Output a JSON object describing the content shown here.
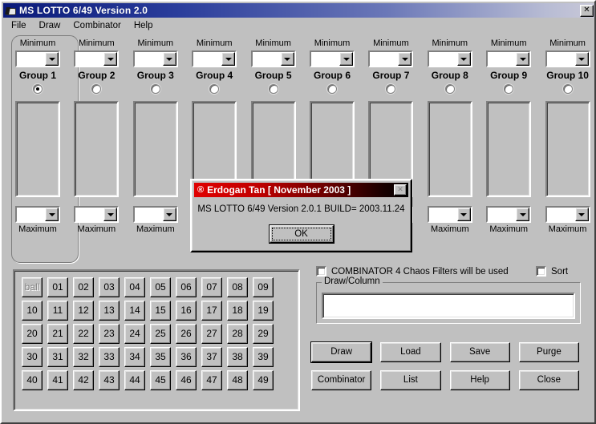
{
  "window": {
    "title": "MS LOTTO 6/49 Version 2.0",
    "icon": "app-icon",
    "close_label": "✕"
  },
  "menu": {
    "items": [
      {
        "label": "File"
      },
      {
        "label": "Draw"
      },
      {
        "label": "Combinator"
      },
      {
        "label": "Help"
      }
    ]
  },
  "groups": {
    "minimum_label": "Minimum",
    "maximum_label": "Maximum",
    "items": [
      {
        "label": "Group 1",
        "selected": true,
        "minimum": "",
        "maximum": ""
      },
      {
        "label": "Group 2",
        "selected": false,
        "minimum": "",
        "maximum": ""
      },
      {
        "label": "Group 3",
        "selected": false,
        "minimum": "",
        "maximum": ""
      },
      {
        "label": "Group 4",
        "selected": false,
        "minimum": "",
        "maximum": ""
      },
      {
        "label": "Group 5",
        "selected": false,
        "minimum": "",
        "maximum": ""
      },
      {
        "label": "Group 6",
        "selected": false,
        "minimum": "",
        "maximum": ""
      },
      {
        "label": "Group 7",
        "selected": false,
        "minimum": "",
        "maximum": ""
      },
      {
        "label": "Group 8",
        "selected": false,
        "minimum": "",
        "maximum": ""
      },
      {
        "label": "Group 9",
        "selected": false,
        "minimum": "",
        "maximum": ""
      },
      {
        "label": "Group 10",
        "selected": false,
        "minimum": "",
        "maximum": ""
      }
    ]
  },
  "number_grid": {
    "rows": [
      [
        "ball",
        "01",
        "02",
        "03",
        "04",
        "05",
        "06",
        "07",
        "08",
        "09"
      ],
      [
        "10",
        "11",
        "12",
        "13",
        "14",
        "15",
        "16",
        "17",
        "18",
        "19"
      ],
      [
        "20",
        "21",
        "22",
        "23",
        "24",
        "25",
        "26",
        "27",
        "28",
        "29"
      ],
      [
        "30",
        "31",
        "32",
        "33",
        "34",
        "35",
        "36",
        "37",
        "38",
        "39"
      ],
      [
        "40",
        "41",
        "42",
        "43",
        "44",
        "45",
        "46",
        "47",
        "48",
        "49"
      ]
    ],
    "disabled_cells": [
      "ball"
    ]
  },
  "options": {
    "combinator_filter": {
      "label": "COMBINATOR 4 Chaos Filters will be used",
      "checked": false
    },
    "sort": {
      "label": "Sort",
      "checked": false
    }
  },
  "draw_column": {
    "legend": "Draw/Column",
    "value": "",
    "placeholder": ""
  },
  "buttons": {
    "row1": [
      {
        "label": "Draw",
        "default": true
      },
      {
        "label": "Load",
        "default": false
      },
      {
        "label": "Save",
        "default": false
      },
      {
        "label": "Purge",
        "default": false
      }
    ],
    "row2": [
      {
        "label": "Combinator",
        "default": false
      },
      {
        "label": "List",
        "default": false
      },
      {
        "label": "Help",
        "default": false
      },
      {
        "label": "Close",
        "default": false
      }
    ]
  },
  "dialog": {
    "registered_mark": "®",
    "title": "Erdogan Tan [ November 2003 ]",
    "close_label": "✕",
    "message": "MS LOTTO 6/49 Version 2.0.1 BUILD= 2003.11.24",
    "ok_label": "OK"
  },
  "colors": {
    "face": "#c0c0c0",
    "title_start": "#0a1a7a",
    "title_end": "#c8c8d8",
    "dialog_title_start": "#e00000",
    "dialog_title_end": "#000000",
    "text": "#000000",
    "disabled_text": "#808080"
  }
}
